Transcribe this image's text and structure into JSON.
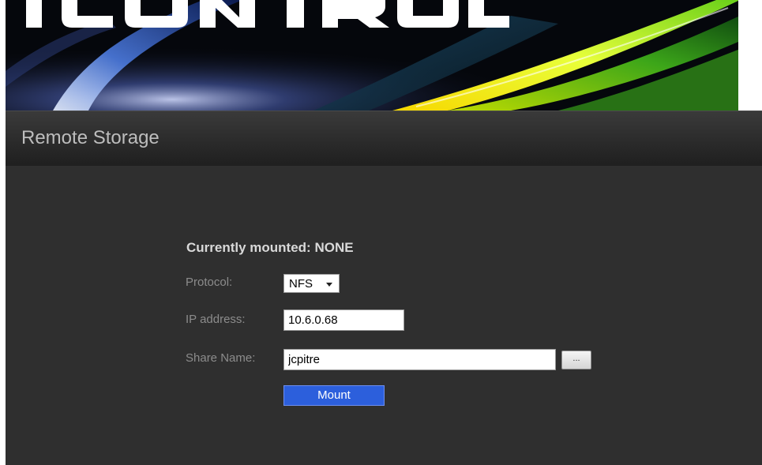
{
  "banner": {
    "logo_text": "ICONTROL"
  },
  "page": {
    "title": "Remote Storage"
  },
  "form": {
    "status": "Currently mounted: NONE",
    "protocol": {
      "label": "Protocol:",
      "selected": "NFS"
    },
    "ip_address": {
      "label": "IP address:",
      "value": "10.6.0.68"
    },
    "share_name": {
      "label": "Share Name:",
      "value": "jcpitre"
    },
    "browse_label": "...",
    "mount_label": "Mount"
  },
  "colors": {
    "background": "#2f2f2f",
    "mount_button": "#2c5fdc",
    "label_text": "#8c8c8c",
    "status_text": "#d9d9d9"
  }
}
